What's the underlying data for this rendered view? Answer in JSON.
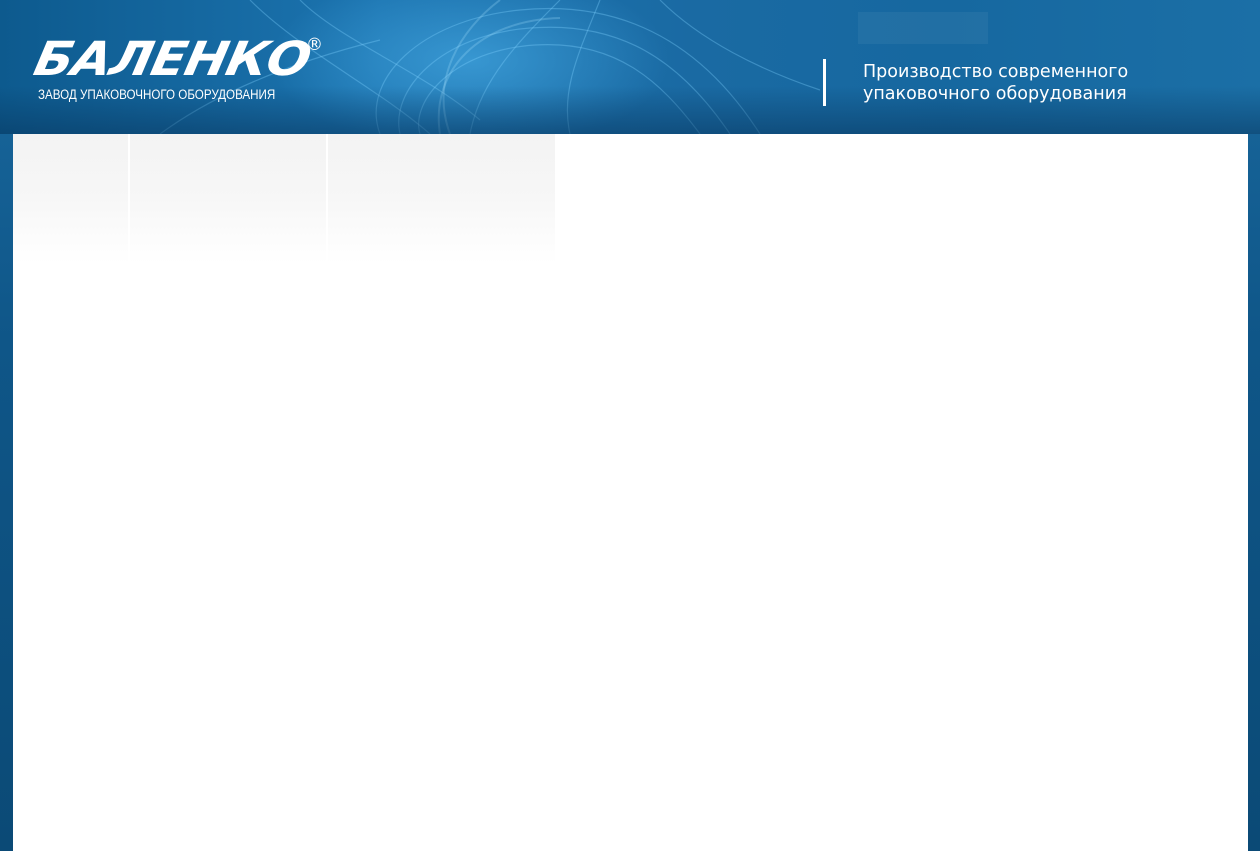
{
  "brand": {
    "logo_text": "БАЛЕНКО",
    "registered_mark": "®",
    "subtitle": "ЗАВОД УПАКОВОЧНОГО ОБОРУДОВАНИЯ"
  },
  "tagline": {
    "line1": "Производство современного",
    "line2": "упаковочного оборудования"
  },
  "colors": {
    "header_blue": "#1a6aa0",
    "dark_frame": "#0d4c78",
    "content_bg": "#ffffff"
  }
}
